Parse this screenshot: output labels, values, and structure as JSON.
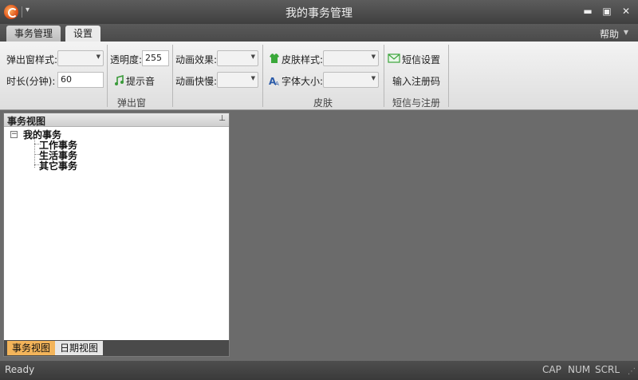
{
  "window": {
    "title": "我的事务管理"
  },
  "tabs": [
    {
      "label": "事务管理"
    },
    {
      "label": "设置"
    }
  ],
  "help": {
    "label": "帮助"
  },
  "ribbon": {
    "popup": {
      "style_label": "弹出窗样式:",
      "duration_label": "时长(分钟):",
      "duration_value": "60",
      "opacity_label": "透明度:",
      "opacity_value": "255",
      "sound_label": "提示音",
      "anim_effect_label": "动画效果:",
      "anim_speed_label": "动画快慢:",
      "group_label": "弹出窗"
    },
    "skin": {
      "skin_style_label": "皮肤样式:",
      "font_size_label": "字体大小:",
      "group_label": "皮肤"
    },
    "sms": {
      "sms_settings_label": "短信设置",
      "register_label": "输入注册码",
      "group_label": "短信与注册"
    }
  },
  "panel": {
    "title": "事务视图",
    "tree": {
      "root": "我的事务",
      "children": [
        "工作事务",
        "生活事务",
        "其它事务"
      ]
    },
    "bottom_tabs": [
      {
        "label": "事务视图"
      },
      {
        "label": "日期视图"
      }
    ]
  },
  "status": {
    "text": "Ready",
    "indicators": [
      "CAP",
      "NUM",
      "SCRL"
    ]
  },
  "colors": {
    "title_bg": "#4a4a4a",
    "workspace_bg": "#6b6b6b",
    "active_bottom_tab": "#f3b45a",
    "sms_icon": "#3ca53c"
  }
}
